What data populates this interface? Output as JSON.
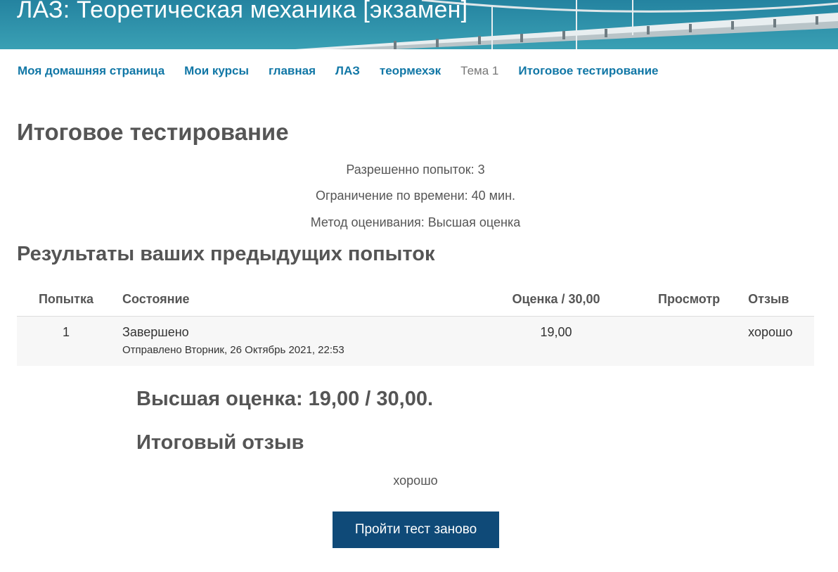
{
  "header": {
    "title": "ЛАЗ: Теоретическая механика [экзамен]"
  },
  "breadcrumb": [
    {
      "label": "Моя домашняя страница",
      "link": true
    },
    {
      "label": "Мои курсы",
      "link": true
    },
    {
      "label": "главная",
      "link": true
    },
    {
      "label": "ЛАЗ",
      "link": true
    },
    {
      "label": "теормехэк",
      "link": true
    },
    {
      "label": "Тема 1",
      "link": false
    },
    {
      "label": "Итоговое тестирование",
      "link": true
    }
  ],
  "page": {
    "title": "Итоговое тестирование",
    "attempts_allowed": "Разрешенно попыток: 3",
    "time_limit": "Ограничение по времени: 40 мин.",
    "grading_method": "Метод оценивания: Высшая оценка"
  },
  "results": {
    "title": "Результаты ваших предыдущих попыток",
    "columns": {
      "attempt": "Попытка",
      "state": "Состояние",
      "grade": "Оценка / 30,00",
      "review": "Просмотр",
      "feedback": "Отзыв"
    },
    "rows": [
      {
        "attempt": "1",
        "state": "Завершено",
        "submitted": "Отправлено Вторник, 26 Октябрь 2021, 22:53",
        "grade": "19,00",
        "review": "",
        "feedback": "хорошо"
      }
    ]
  },
  "summary": {
    "best_grade": "Высшая оценка: 19,00 / 30,00.",
    "feedback_title": "Итоговый отзыв",
    "feedback_text": "хорошо"
  },
  "actions": {
    "retry_label": "Пройти тест заново"
  },
  "colors": {
    "link": "#1177a6",
    "button": "#0f4a78",
    "banner": "#1f7f96"
  }
}
